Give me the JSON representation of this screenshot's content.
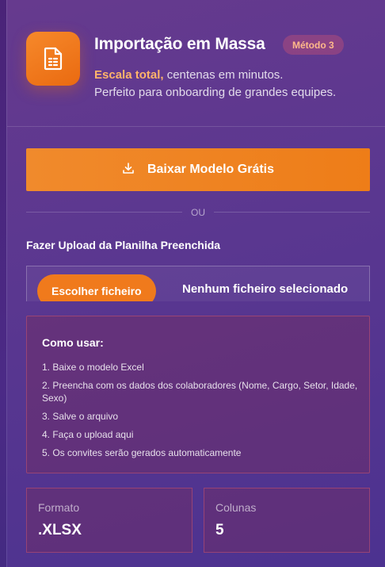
{
  "header": {
    "icon": "spreadsheet-file-icon",
    "title": "Importação em Massa",
    "badge": "Método 3",
    "highlight": "Escala total,",
    "desc_rest": "centenas em minutos.",
    "desc_line2": "Perfeito para onboarding de grandes equipes."
  },
  "download": {
    "icon": "download-icon",
    "label": "Baixar Modelo Grátis"
  },
  "divider": {
    "or": "OU"
  },
  "upload": {
    "label": "Fazer Upload da Planilha Preenchida",
    "choose_button": "Escolher ficheiro",
    "no_file": "Nenhum ficheiro selecionado"
  },
  "howto": {
    "title": "Como usar:",
    "steps": [
      "1. Baixe o modelo Excel",
      "2. Preencha com os dados dos colaboradores (Nome, Cargo, Setor, Idade, Sexo)",
      "3. Salve o arquivo",
      "4. Faça o upload aqui",
      "5. Os convites serão gerados automaticamente"
    ]
  },
  "stats": [
    {
      "label": "Formato",
      "value": ".XLSX"
    },
    {
      "label": "Colunas",
      "value": "5"
    }
  ],
  "colors": {
    "accent": "#f07a1c",
    "badge_text": "#ffb98a",
    "highlight": "#ffb46a"
  }
}
